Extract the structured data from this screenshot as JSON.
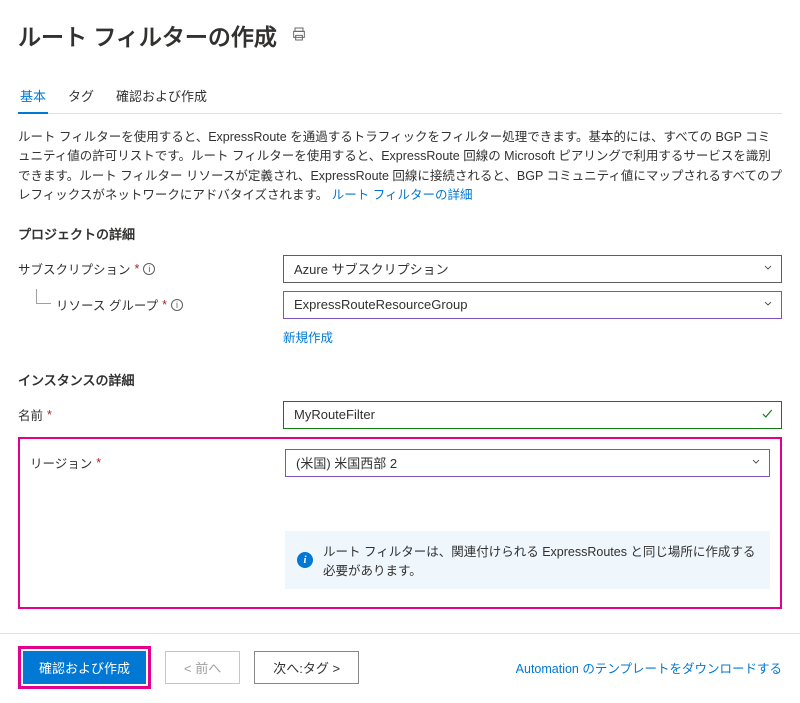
{
  "header": {
    "title": "ルート フィルターの作成"
  },
  "tabs": {
    "basic": "基本",
    "tags": "タグ",
    "review": "確認および作成"
  },
  "description": {
    "text": "ルート フィルターを使用すると、ExpressRoute を通過するトラフィックをフィルター処理できます。基本的には、すべての BGP コミュニティ値の許可リストです。ルート フィルターを使用すると、ExpressRoute 回線の Microsoft ピアリングで利用するサービスを識別できます。ルート フィルター リソースが定義され、ExpressRoute 回線に接続されると、BGP コミュニティ値にマップされるすべてのプレフィックスがネットワークにアドバタイズされます。",
    "link": "ルート フィルターの詳細"
  },
  "project": {
    "title": "プロジェクトの詳細",
    "subscriptionLabel": "サブスクリプション",
    "subscriptionValue": "Azure サブスクリプション",
    "resourceGroupLabel": "リソース グループ",
    "resourceGroupValue": "ExpressRouteResourceGroup",
    "createNew": "新規作成"
  },
  "instance": {
    "title": "インスタンスの詳細",
    "nameLabel": "名前",
    "nameValue": "MyRouteFilter",
    "regionLabel": "リージョン",
    "regionValue": "(米国) 米国西部 2",
    "infoMessage": "ルート フィルターは、関連付けられる ExpressRoutes と同じ場所に作成する必要があります。"
  },
  "footer": {
    "review": "確認および作成",
    "prev": "< 前へ",
    "next": "次へ:タグ >",
    "download": "Automation のテンプレートをダウンロードする"
  }
}
